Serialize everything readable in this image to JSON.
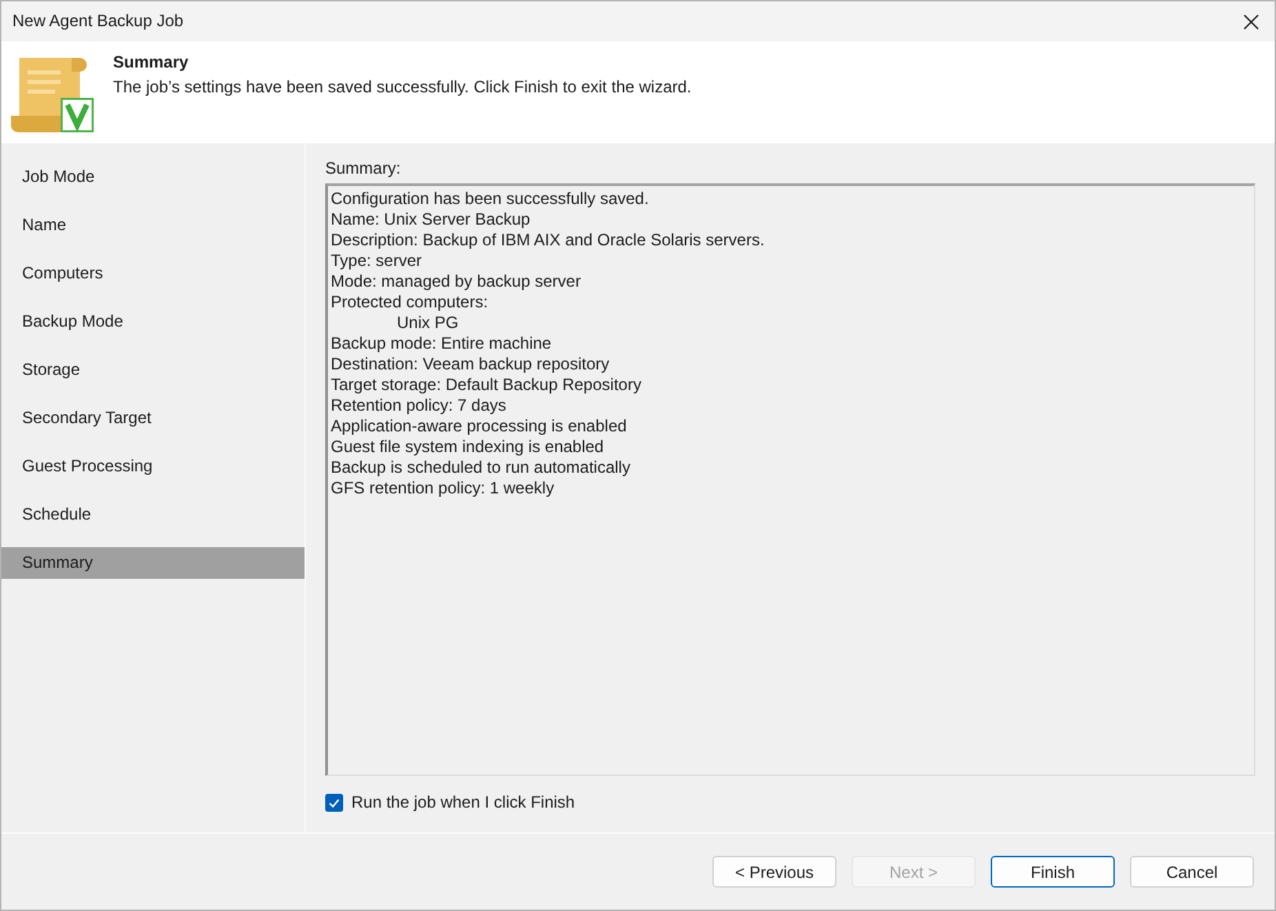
{
  "window": {
    "title": "New Agent Backup Job"
  },
  "header": {
    "title": "Summary",
    "subtitle": "The job’s settings have been saved successfully. Click Finish to exit the wizard."
  },
  "steps": [
    {
      "label": "Job Mode",
      "selected": false
    },
    {
      "label": "Name",
      "selected": false
    },
    {
      "label": "Computers",
      "selected": false
    },
    {
      "label": "Backup Mode",
      "selected": false
    },
    {
      "label": "Storage",
      "selected": false
    },
    {
      "label": "Secondary Target",
      "selected": false
    },
    {
      "label": "Guest Processing",
      "selected": false
    },
    {
      "label": "Schedule",
      "selected": false
    },
    {
      "label": "Summary",
      "selected": true
    }
  ],
  "summary": {
    "label": "Summary:",
    "lines": [
      {
        "text": "Configuration has been successfully saved."
      },
      {
        "text": "Name: Unix Server Backup"
      },
      {
        "text": "Description: Backup of IBM AIX and Oracle Solaris servers."
      },
      {
        "text": "Type: server"
      },
      {
        "text": "Mode: managed by backup server"
      },
      {
        "text": "Protected computers:",
        "children": [
          {
            "text": "Unix PG"
          }
        ]
      },
      {
        "text": "Backup mode: Entire machine"
      },
      {
        "text": "Destination: Veeam backup repository"
      },
      {
        "text": "Target storage: Default Backup Repository"
      },
      {
        "text": "Retention policy: 7 days"
      },
      {
        "text": "Application-aware processing is enabled"
      },
      {
        "text": "Guest file system indexing is enabled"
      },
      {
        "text": "Backup is scheduled to run automatically"
      },
      {
        "text": "GFS retention policy: 1 weekly"
      }
    ]
  },
  "run_option": {
    "label": "Run the job when I click Finish",
    "checked": true
  },
  "buttons": [
    {
      "label": "< Previous",
      "disabled": false,
      "default": false
    },
    {
      "label": "Next >",
      "disabled": true,
      "default": false
    },
    {
      "label": "Finish",
      "disabled": false,
      "default": true
    },
    {
      "label": "Cancel",
      "disabled": false,
      "default": false
    }
  ]
}
